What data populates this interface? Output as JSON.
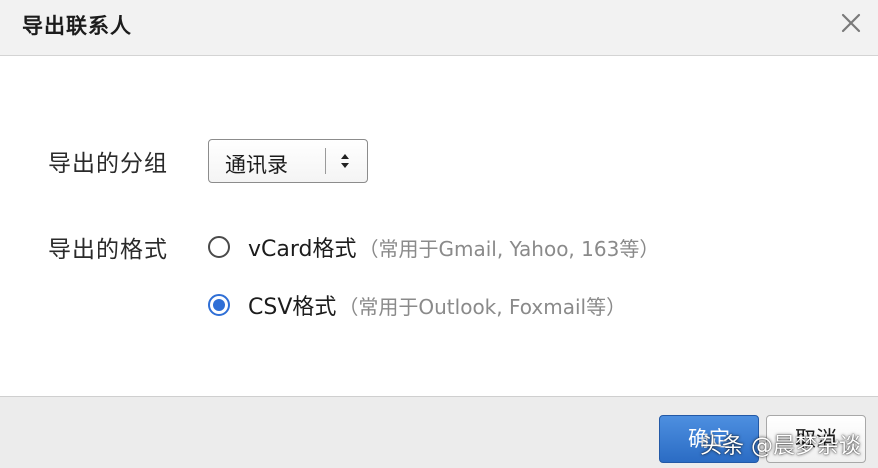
{
  "dialog": {
    "title": "导出联系人",
    "close_icon": "close-icon"
  },
  "group": {
    "label": "导出的分组",
    "selected": "通讯录",
    "arrows_icon": "updown-arrows-icon"
  },
  "format": {
    "label": "导出的格式",
    "options": [
      {
        "label": "vCard格式",
        "hint": "（常用于Gmail, Yahoo, 163等）",
        "checked": false
      },
      {
        "label": "CSV格式",
        "hint": "（常用于Outlook, Foxmail等）",
        "checked": true
      }
    ]
  },
  "footer": {
    "confirm_label": "确定",
    "cancel_label": "取消"
  },
  "watermark": {
    "text": "头条 @晨梦杂谈"
  },
  "colors": {
    "accent": "#2f6fd6",
    "title_bg": "#f2f2f2",
    "footer_bg": "#ececec"
  }
}
